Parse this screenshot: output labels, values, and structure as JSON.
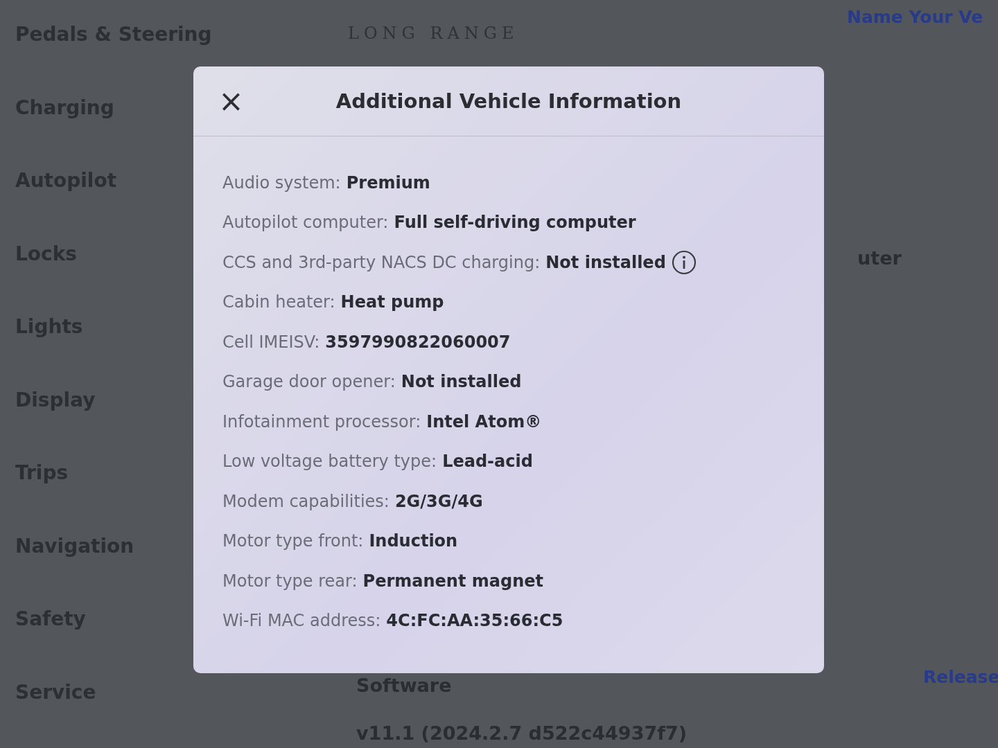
{
  "sidebar": {
    "items": [
      {
        "label": "Pedals & Steering"
      },
      {
        "label": "Charging"
      },
      {
        "label": "Autopilot"
      },
      {
        "label": "Locks"
      },
      {
        "label": "Lights"
      },
      {
        "label": "Display"
      },
      {
        "label": "Trips"
      },
      {
        "label": "Navigation"
      },
      {
        "label": "Safety"
      },
      {
        "label": "Service"
      }
    ]
  },
  "background": {
    "trim": "LONG RANGE",
    "name_link": "Name Your Ve",
    "partial_value": "uter",
    "release_link": "Release",
    "software_label": "Software",
    "software_version": "v11.1 (2024.2.7 d522c44937f7)"
  },
  "dialog": {
    "title": "Additional Vehicle Information",
    "close": "×",
    "rows": [
      {
        "label": "Audio system:",
        "value": "Premium",
        "info": false
      },
      {
        "label": "Autopilot computer:",
        "value": "Full self-driving computer",
        "info": false
      },
      {
        "label": "CCS and 3rd-party NACS DC charging:",
        "value": "Not installed",
        "info": true
      },
      {
        "label": "Cabin heater:",
        "value": "Heat pump",
        "info": false
      },
      {
        "label": "Cell IMEISV:",
        "value": "3597990822060007",
        "info": false
      },
      {
        "label": "Garage door opener:",
        "value": "Not installed",
        "info": false
      },
      {
        "label": "Infotainment processor:",
        "value": "Intel Atom®",
        "info": false
      },
      {
        "label": "Low voltage battery type:",
        "value": "Lead-acid",
        "info": false
      },
      {
        "label": "Modem capabilities:",
        "value": "2G/3G/4G",
        "info": false
      },
      {
        "label": "Motor type front:",
        "value": "Induction",
        "info": false
      },
      {
        "label": "Motor type rear:",
        "value": "Permanent magnet",
        "info": false
      },
      {
        "label": "Wi-Fi MAC address:",
        "value": "4C:FC:AA:35:66:C5",
        "info": false
      }
    ]
  }
}
